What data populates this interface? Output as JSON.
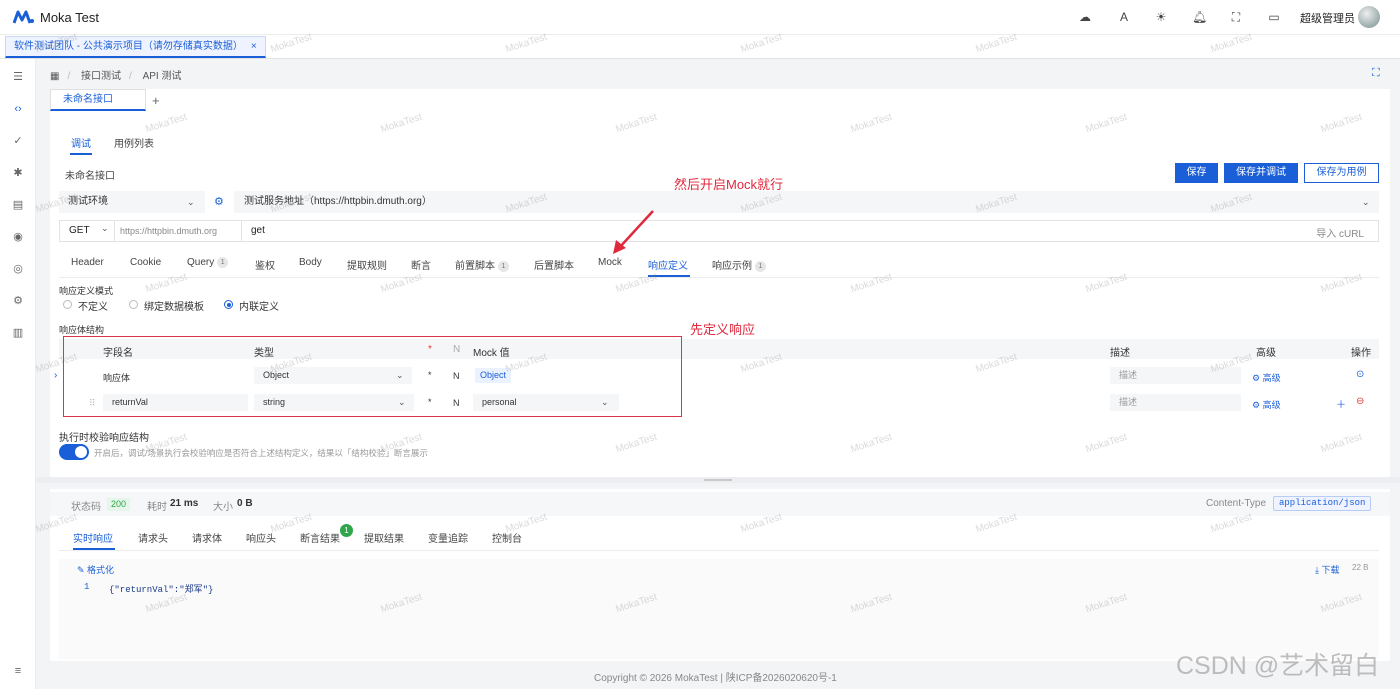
{
  "app": {
    "title": "Moka Test",
    "username": "超级管理员"
  },
  "project_tab": {
    "label": "软件测试团队 - 公共演示项目（请勿存储真实数据）",
    "close": "×"
  },
  "breadcrumb": [
    "接口测试",
    "/",
    "API 测试"
  ],
  "doc_tab": {
    "label": "未命名接口",
    "add": "+"
  },
  "subtabs": [
    "调试",
    "用例列表"
  ],
  "api_name": "未命名接口",
  "buttons": {
    "save": "保存",
    "save_debug": "保存并调试",
    "save_case": "保存为用例"
  },
  "env": {
    "label": "测试环境",
    "server": "测试服务地址（https://httpbin.dmuth.org）"
  },
  "request": {
    "method": "GET",
    "base_url": "https://httpbin.dmuth.org",
    "path": "get",
    "import_curl": "导入 cURL"
  },
  "req_tabs": [
    {
      "label": "Header"
    },
    {
      "label": "Cookie"
    },
    {
      "label": "Query",
      "count": "1"
    },
    {
      "label": "鉴权"
    },
    {
      "label": "Body"
    },
    {
      "label": "提取规则"
    },
    {
      "label": "断言"
    },
    {
      "label": "前置脚本",
      "count": "1"
    },
    {
      "label": "后置脚本"
    },
    {
      "label": "Mock"
    },
    {
      "label": "响应定义"
    },
    {
      "label": "响应示例",
      "count": "1"
    }
  ],
  "response_def": {
    "mode_label": "响应定义模式",
    "modes": [
      "不定义",
      "绑定数据模板",
      "内联定义"
    ],
    "selected_mode": "内联定义",
    "struct_label": "响应体结构",
    "columns": {
      "field": "字段名",
      "type": "类型",
      "required": "*",
      "nullable": "N",
      "mock": "Mock 值",
      "desc": "描述",
      "adv": "高级",
      "ops": "操作"
    },
    "rows": [
      {
        "field": "响应体",
        "type": "Object",
        "mock": "Object",
        "desc_placeholder": "描述",
        "adv": "高级"
      },
      {
        "field": "returnVal",
        "type": "string",
        "mock": "personal",
        "desc_placeholder": "描述",
        "adv": "高级"
      }
    ],
    "validate_label": "执行时校验响应结构",
    "validate_hint": "开启后，调试/场景执行会校验响应是否符合上述结构定义，结果以「结构校验」断言展示"
  },
  "annotations": {
    "mock_note": "然后开启Mock就行",
    "define_note": "先定义响应"
  },
  "response": {
    "status_label": "状态码",
    "status": "200",
    "time_label": "耗时",
    "time": "21 ms",
    "size_label": "大小",
    "size": "0 B",
    "content_type_label": "Content-Type",
    "content_type": "application/json",
    "tabs": [
      "实时响应",
      "请求头",
      "请求体",
      "响应头",
      "断言结果",
      "提取结果",
      "变量追踪",
      "控制台"
    ],
    "assert_count": "1",
    "format": "格式化",
    "download": "下载",
    "body_size": "22 B",
    "line_no": "1",
    "body": "{\"returnVal\":\"郑军\"}"
  },
  "footer": "Copyright © 2026 MokaTest | 陕ICP备2026020620号-1",
  "watermark": "MokaTest",
  "csdn_mark": "CSDN @艺术留白",
  "colors": {
    "accent": "#1a5fd8",
    "annotation": "#e0293d",
    "success": "#2fa64a"
  }
}
